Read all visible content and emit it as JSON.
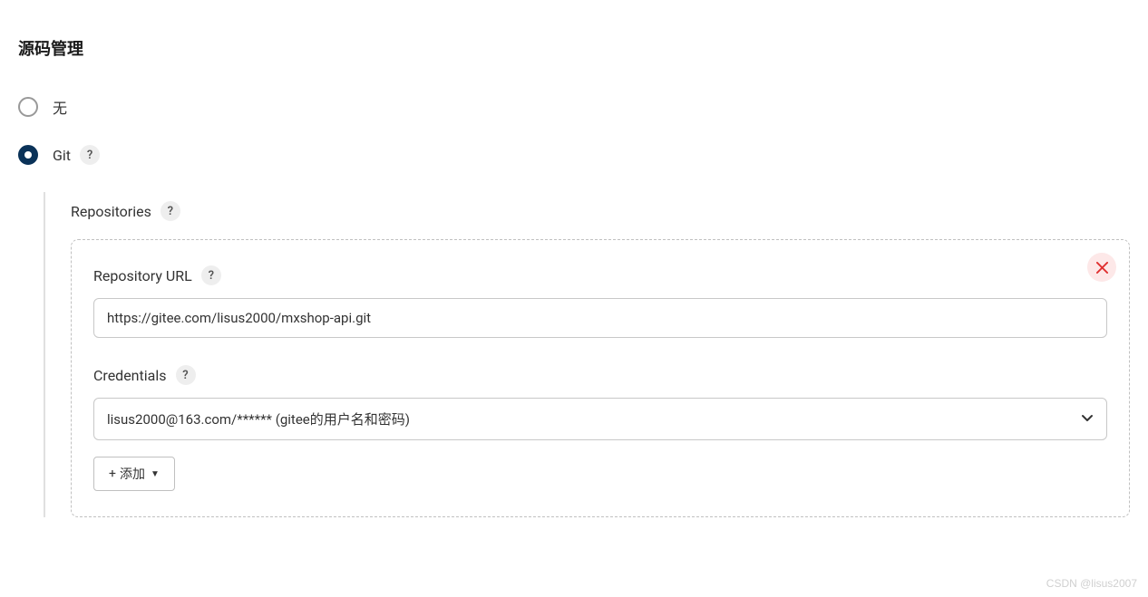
{
  "section": {
    "title": "源码管理"
  },
  "scm": {
    "options": {
      "none": {
        "label": "无"
      },
      "git": {
        "label": "Git"
      }
    },
    "repositories_label": "Repositories",
    "repo": {
      "url_label": "Repository URL",
      "url_value": "https://gitee.com/lisus2000/mxshop-api.git",
      "credentials_label": "Credentials",
      "credentials_value": "lisus2000@163.com/****** (gitee的用户名和密码)",
      "add_button": "添加"
    }
  },
  "help_glyph": "?",
  "watermark": "CSDN @lisus2007"
}
